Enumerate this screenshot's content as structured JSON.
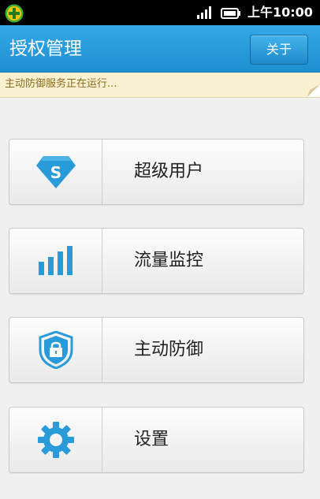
{
  "status_bar": {
    "time": "上午10:00",
    "icons": [
      "app-notification-icon",
      "signal-icon",
      "battery-icon"
    ]
  },
  "header": {
    "title": "授权管理",
    "about_label": "关于"
  },
  "notice": {
    "text": "主动防御服务正在运行..."
  },
  "menu": {
    "items": [
      {
        "label": "超级用户",
        "icon": "superuser-shield-icon"
      },
      {
        "label": "流量监控",
        "icon": "signal-bars-icon"
      },
      {
        "label": "主动防御",
        "icon": "lock-shield-icon"
      },
      {
        "label": "设置",
        "icon": "gear-icon"
      }
    ]
  },
  "colors": {
    "accent": "#2a9bd9",
    "status_bar": "#000000",
    "notice_bg": "#faf1d2",
    "notice_text": "#8a6a1f",
    "app_icon_green": "#3bb13a",
    "app_icon_yellow": "#f5c400"
  }
}
